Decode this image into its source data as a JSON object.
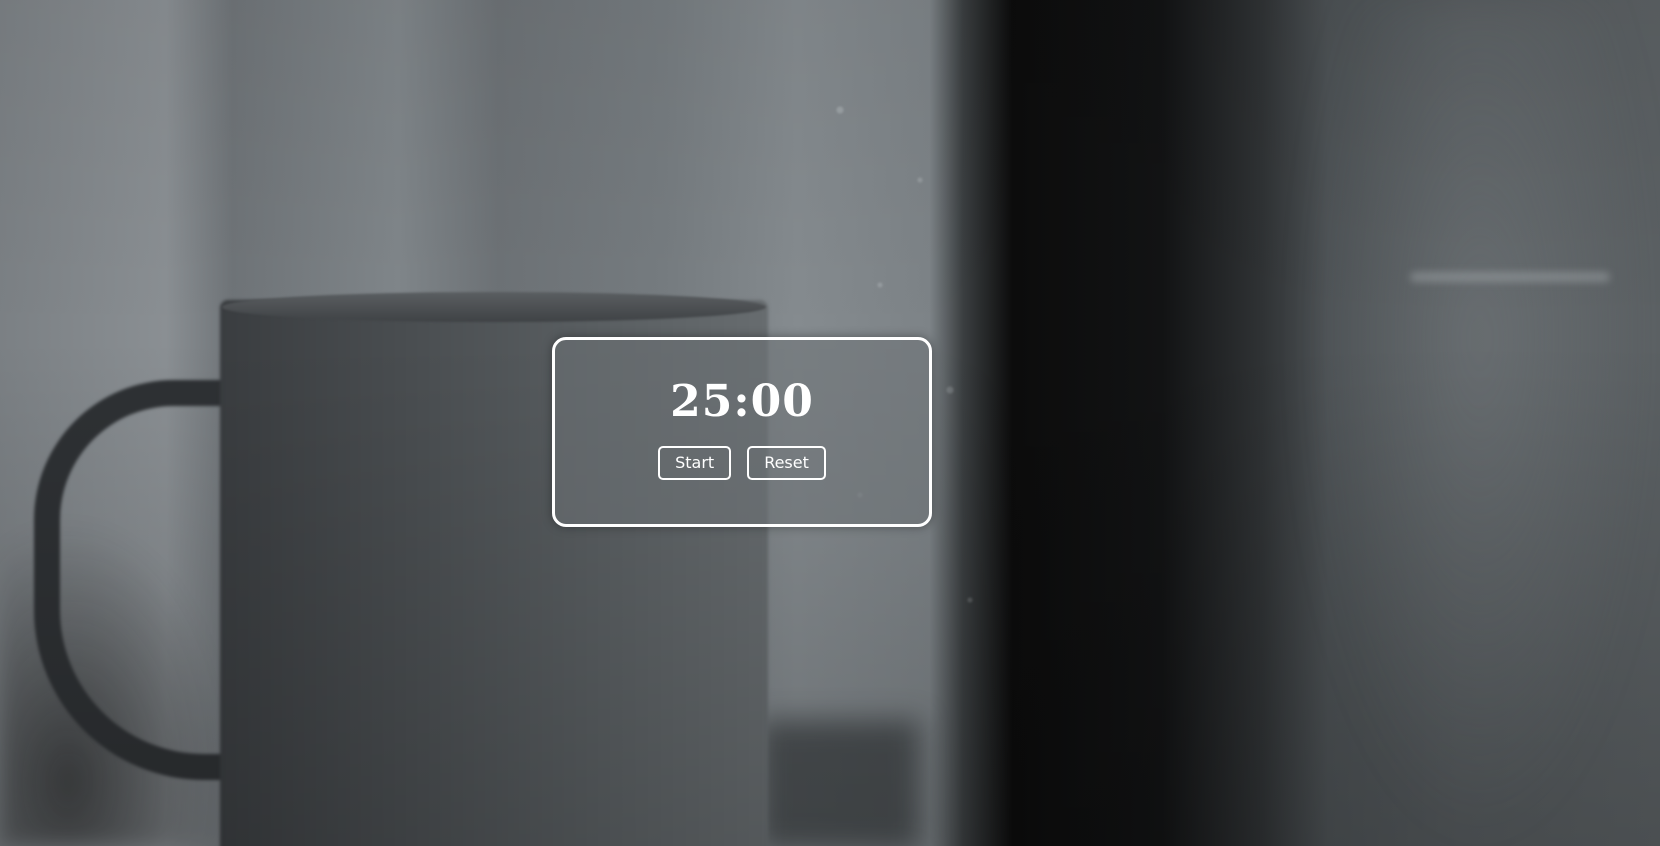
{
  "timer": {
    "display": "25:00"
  },
  "controls": {
    "start_label": "Start",
    "reset_label": "Reset"
  }
}
